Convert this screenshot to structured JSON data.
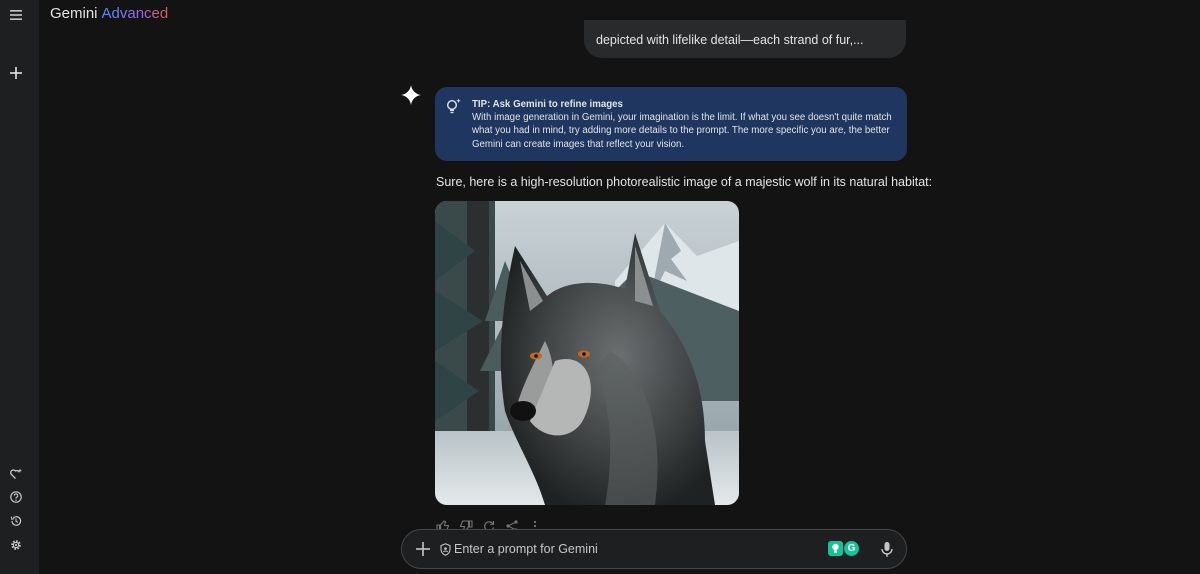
{
  "header": {
    "brand_main": "Gemini",
    "brand_tier": "Advanced"
  },
  "sidebar": {
    "items": [
      {
        "name": "menu",
        "icon": "hamburger-menu-icon"
      },
      {
        "name": "new-chat",
        "icon": "plus-icon"
      },
      {
        "name": "gem-manager",
        "icon": "heart-sparkle-icon"
      },
      {
        "name": "help",
        "icon": "help-circle-icon"
      },
      {
        "name": "activity",
        "icon": "history-icon"
      },
      {
        "name": "settings",
        "icon": "gear-icon"
      }
    ]
  },
  "conversation": {
    "user_message_tail": "depicted with lifelike detail—each strand of fur,...",
    "tip": {
      "title": "TIP: Ask Gemini to refine images",
      "body": "With image generation in Gemini, your imagination is the limit. If what you see doesn't quite match what you had in mind, try adding more details to the prompt. The more specific you are, the better Gemini can create images that reflect your vision."
    },
    "response_text": "Sure, here is a high-resolution photorealistic image of a majestic wolf in its natural habitat:",
    "actions": [
      "thumbs-up-icon",
      "thumbs-down-icon",
      "regenerate-icon",
      "share-icon",
      "more-vert-icon"
    ]
  },
  "prompt_bar": {
    "placeholder": "Enter a prompt for Gemini",
    "value": ""
  },
  "colors": {
    "background": "#131314",
    "rail": "#1e1f20",
    "tip_card": "#1f3760",
    "user_bubble": "#282a2c",
    "extension_green": "#15c39a"
  }
}
